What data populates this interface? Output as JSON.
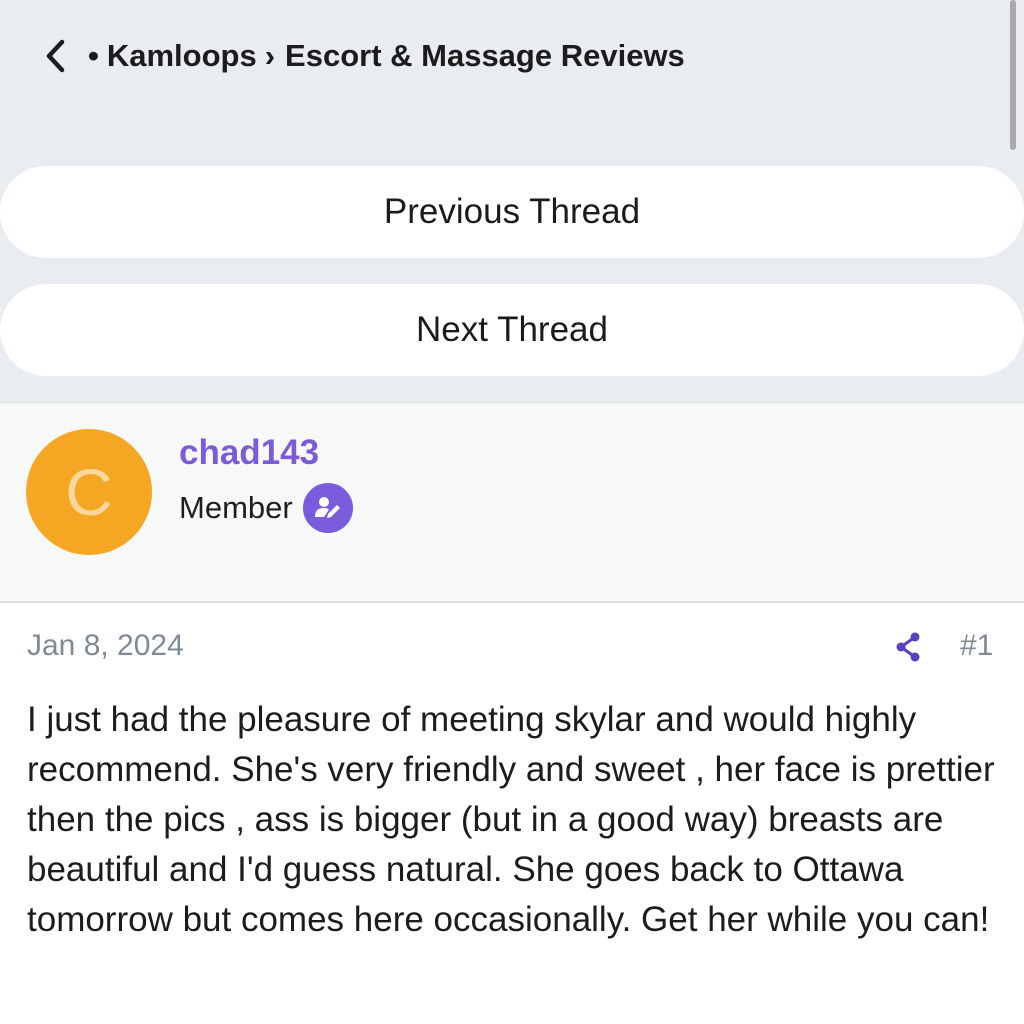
{
  "breadcrumb": {
    "bullet": "•",
    "parent": "Kamloops",
    "separator": "›",
    "current": "Escort & Massage Reviews"
  },
  "nav": {
    "previous_label": "Previous Thread",
    "next_label": "Next Thread"
  },
  "author": {
    "avatar_letter": "C",
    "avatar_color": "#f5a623",
    "username": "chad143",
    "username_color": "#7c5cd6",
    "role": "Member",
    "role_badge_icon": "user-edit-icon"
  },
  "post": {
    "date": "Jan 8, 2024",
    "number": "#1",
    "share_icon": "share-icon",
    "body": "I just had the pleasure of meeting skylar and would highly recommend. She's very friendly and sweet , her face is prettier then the pics , ass is bigger (but in a good way) breasts are beautiful and I'd guess natural. She goes back to Ottawa tomorrow but comes here occasionally. Get her while you can!"
  }
}
